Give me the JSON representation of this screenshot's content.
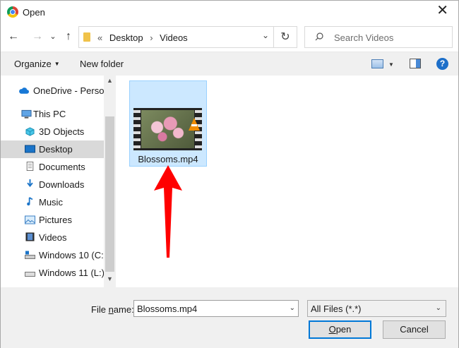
{
  "titlebar": {
    "title": "Open",
    "close_glyph": "✕"
  },
  "nav": {
    "back_glyph": "←",
    "forward_glyph": "→",
    "recent_glyph": "⌄",
    "up_glyph": "↑",
    "breadcrumbs": [
      "«",
      "Desktop",
      "›",
      "Videos"
    ],
    "address_dropdown_glyph": "⌄",
    "refresh_glyph": "↻",
    "search_placeholder": "Search Videos"
  },
  "toolbar": {
    "organize_label": "Organize",
    "organize_caret": "▼",
    "new_folder_label": "New folder",
    "view_caret": "▼",
    "help_glyph": "?"
  },
  "sidebar": {
    "items": [
      {
        "label": "OneDrive - Person",
        "icon": "cloud-icon"
      },
      {
        "label": "This PC",
        "icon": "computer-icon"
      },
      {
        "label": "3D Objects",
        "icon": "cube-icon"
      },
      {
        "label": "Desktop",
        "icon": "desktop-icon",
        "selected": true
      },
      {
        "label": "Documents",
        "icon": "document-icon"
      },
      {
        "label": "Downloads",
        "icon": "download-icon"
      },
      {
        "label": "Music",
        "icon": "music-icon"
      },
      {
        "label": "Pictures",
        "icon": "pictures-icon"
      },
      {
        "label": "Videos",
        "icon": "videos-icon"
      },
      {
        "label": "Windows 10 (C:)",
        "icon": "drive-icon"
      },
      {
        "label": "Windows 11 (L:)",
        "icon": "drive-icon"
      }
    ],
    "scroll_up_glyph": "▲",
    "scroll_down_glyph": "▼"
  },
  "content": {
    "files": [
      {
        "name": "Blossoms.mp4",
        "selected": true
      }
    ],
    "annotation_arrow_color": "#ff0000"
  },
  "footer": {
    "file_name_label_prefix": "File ",
    "file_name_label_underlined": "n",
    "file_name_label_suffix": "ame:",
    "file_name_value": "Blossoms.mp4",
    "file_type_value": "All Files (*.*)",
    "dropdown_glyph": "⌄",
    "open_label_underlined": "O",
    "open_label_rest": "pen",
    "cancel_label": "Cancel"
  },
  "colors": {
    "selection_bg": "#cce8ff",
    "selection_border": "#99d1ff",
    "accent": "#0078d7"
  }
}
